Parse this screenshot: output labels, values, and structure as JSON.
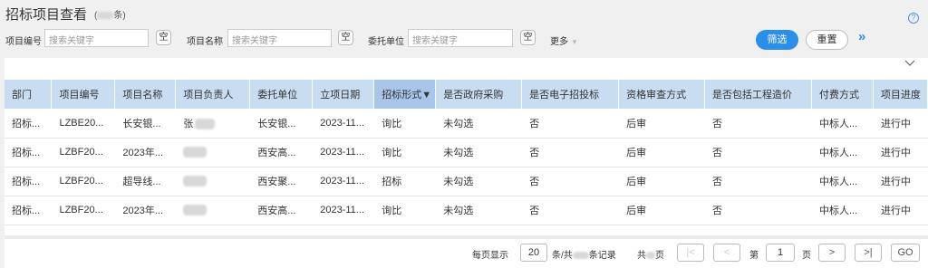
{
  "header": {
    "title": "招标项目查看",
    "count_prefix": "(",
    "count_suffix": "条)",
    "help_label": "?"
  },
  "filters": [
    {
      "label": "项目编号",
      "placeholder": "搜索关键字",
      "clear_label": "空"
    },
    {
      "label": "项目名称",
      "placeholder": "搜索关键字",
      "clear_label": "空"
    },
    {
      "label": "委托单位",
      "placeholder": "搜索关键字",
      "clear_label": "空"
    }
  ],
  "toolbar": {
    "more_label": "更多",
    "filter_button": "筛选",
    "reset_button": "重置",
    "expand_label": "»"
  },
  "table": {
    "columns": [
      "部门",
      "项目编号",
      "项目名称",
      "项目负责人",
      "委托单位",
      "立项日期",
      "招标形式▼",
      "是否政府采购",
      "是否电子招投标",
      "资格审查方式",
      "是否包括工程造价",
      "付费方式",
      "项目进度"
    ],
    "rows": [
      [
        "招标...",
        "LZBE20...",
        "长安银...",
        "张",
        "长安银...",
        "2023-11...",
        "询比",
        "未勾选",
        "否",
        "后审",
        "否",
        "中标人...",
        "进行中"
      ],
      [
        "招标...",
        "LZBF20...",
        "2023年...",
        "",
        "西安高...",
        "2023-11...",
        "询比",
        "未勾选",
        "否",
        "后审",
        "否",
        "中标人...",
        "进行中"
      ],
      [
        "招标...",
        "LZBF20...",
        "超导线...",
        "",
        "西安聚...",
        "2023-11...",
        "招标",
        "未勾选",
        "否",
        "后审",
        "否",
        "中标人...",
        "进行中"
      ],
      [
        "招标...",
        "LZBF20...",
        "2023年...",
        "",
        "西安高...",
        "2023-11...",
        "询比",
        "未勾选",
        "否",
        "后审",
        "否",
        "中标人...",
        "进行中"
      ]
    ]
  },
  "pagination": {
    "per_page_label": "每页显示",
    "per_page_value": "20",
    "records_prefix": "条/共",
    "records_suffix": "条记录",
    "pages_prefix": "共",
    "pages_suffix": "页",
    "first_label": "|<",
    "prev_label": "<",
    "page_prefix": "第",
    "page_value": "1",
    "page_suffix": "页",
    "next_label": ">",
    "last_label": ">|",
    "go_label": "GO"
  },
  "colors": {
    "accent": "#2b8ee8",
    "header_bg": "#c8dcf2",
    "active_header_bg": "#a8c6ea"
  }
}
